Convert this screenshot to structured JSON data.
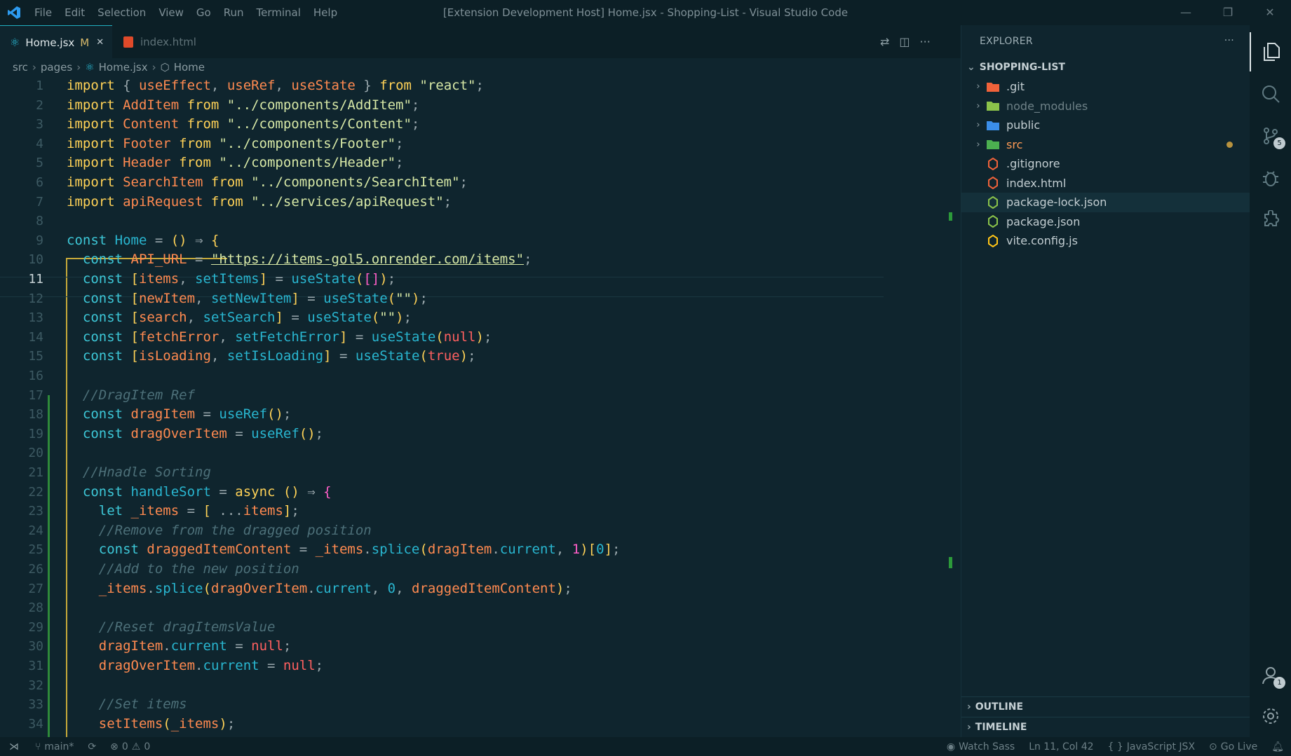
{
  "window": {
    "title": "[Extension Development Host] Home.jsx - Shopping-List - Visual Studio Code",
    "menu": [
      "File",
      "Edit",
      "Selection",
      "View",
      "Go",
      "Run",
      "Terminal",
      "Help"
    ],
    "controls": [
      "—",
      "❐",
      "✕"
    ]
  },
  "tabs": [
    {
      "label": "Home.jsx",
      "badge": "M",
      "close": "✕",
      "active": true
    },
    {
      "label": "index.html",
      "active": false
    }
  ],
  "breadcrumb": [
    "src",
    "pages",
    "Home.jsx",
    "Home"
  ],
  "editor": {
    "current_line": 11,
    "lines": [
      [
        [
          "k",
          "import "
        ],
        [
          "p",
          "{ "
        ],
        [
          "v",
          "useEffect"
        ],
        [
          "p",
          ", "
        ],
        [
          "v",
          "useRef"
        ],
        [
          "p",
          ", "
        ],
        [
          "v",
          "useState"
        ],
        [
          "p",
          " } "
        ],
        [
          "k",
          "from "
        ],
        [
          "s",
          "\"react\""
        ],
        [
          "p",
          ";"
        ]
      ],
      [
        [
          "k",
          "import "
        ],
        [
          "v",
          "AddItem "
        ],
        [
          "k",
          "from "
        ],
        [
          "s",
          "\"../components/AddItem\""
        ],
        [
          "p",
          ";"
        ]
      ],
      [
        [
          "k",
          "import "
        ],
        [
          "v",
          "Content "
        ],
        [
          "k",
          "from "
        ],
        [
          "s",
          "\"../components/Content\""
        ],
        [
          "p",
          ";"
        ]
      ],
      [
        [
          "k",
          "import "
        ],
        [
          "v",
          "Footer "
        ],
        [
          "k",
          "from "
        ],
        [
          "s",
          "\"../components/Footer\""
        ],
        [
          "p",
          ";"
        ]
      ],
      [
        [
          "k",
          "import "
        ],
        [
          "v",
          "Header "
        ],
        [
          "k",
          "from "
        ],
        [
          "s",
          "\"../components/Header\""
        ],
        [
          "p",
          ";"
        ]
      ],
      [
        [
          "k",
          "import "
        ],
        [
          "v",
          "SearchItem "
        ],
        [
          "k",
          "from "
        ],
        [
          "s",
          "\"../components/SearchItem\""
        ],
        [
          "p",
          ";"
        ]
      ],
      [
        [
          "k",
          "import "
        ],
        [
          "v",
          "apiRequest "
        ],
        [
          "k",
          "from "
        ],
        [
          "s",
          "\"../services/apiRequest\""
        ],
        [
          "p",
          ";"
        ]
      ],
      [],
      [
        [
          "c",
          "const "
        ],
        [
          "n",
          "Home "
        ],
        [
          "p",
          "= "
        ],
        [
          "k",
          "() "
        ],
        [
          "p",
          "⇒ "
        ],
        [
          "k",
          "{"
        ]
      ],
      [
        [
          "p",
          "  "
        ],
        [
          "c",
          "const "
        ],
        [
          "v",
          "API_URL "
        ],
        [
          "p",
          "= "
        ],
        [
          "s",
          "\"https://items-gol5.onrender.com/items\""
        ],
        [
          "p",
          ";"
        ]
      ],
      [
        [
          "p",
          "  "
        ],
        [
          "c",
          "const "
        ],
        [
          "k",
          "["
        ],
        [
          "v",
          "items"
        ],
        [
          "p",
          ", "
        ],
        [
          "n",
          "setItems"
        ],
        [
          "k",
          "] "
        ],
        [
          "p",
          "= "
        ],
        [
          "n",
          "useState"
        ],
        [
          "k",
          "("
        ],
        [
          "pk",
          "[]"
        ],
        [
          "k",
          ")"
        ],
        [
          "p",
          ";"
        ]
      ],
      [
        [
          "p",
          "  "
        ],
        [
          "c",
          "const "
        ],
        [
          "k",
          "["
        ],
        [
          "v",
          "newItem"
        ],
        [
          "p",
          ", "
        ],
        [
          "n",
          "setNewItem"
        ],
        [
          "k",
          "] "
        ],
        [
          "p",
          "= "
        ],
        [
          "n",
          "useState"
        ],
        [
          "k",
          "("
        ],
        [
          "s",
          "\"\""
        ],
        [
          "k",
          ")"
        ],
        [
          "p",
          ";"
        ]
      ],
      [
        [
          "p",
          "  "
        ],
        [
          "c",
          "const "
        ],
        [
          "k",
          "["
        ],
        [
          "v",
          "search"
        ],
        [
          "p",
          ", "
        ],
        [
          "n",
          "setSearch"
        ],
        [
          "k",
          "] "
        ],
        [
          "p",
          "= "
        ],
        [
          "n",
          "useState"
        ],
        [
          "k",
          "("
        ],
        [
          "s",
          "\"\""
        ],
        [
          "k",
          ")"
        ],
        [
          "p",
          ";"
        ]
      ],
      [
        [
          "p",
          "  "
        ],
        [
          "c",
          "const "
        ],
        [
          "k",
          "["
        ],
        [
          "v",
          "fetchError"
        ],
        [
          "p",
          ", "
        ],
        [
          "n",
          "setFetchError"
        ],
        [
          "k",
          "] "
        ],
        [
          "p",
          "= "
        ],
        [
          "n",
          "useState"
        ],
        [
          "k",
          "("
        ],
        [
          "r",
          "null"
        ],
        [
          "k",
          ")"
        ],
        [
          "p",
          ";"
        ]
      ],
      [
        [
          "p",
          "  "
        ],
        [
          "c",
          "const "
        ],
        [
          "k",
          "["
        ],
        [
          "v",
          "isLoading"
        ],
        [
          "p",
          ", "
        ],
        [
          "n",
          "setIsLoading"
        ],
        [
          "k",
          "] "
        ],
        [
          "p",
          "= "
        ],
        [
          "n",
          "useState"
        ],
        [
          "k",
          "("
        ],
        [
          "r",
          "true"
        ],
        [
          "k",
          ")"
        ],
        [
          "p",
          ";"
        ]
      ],
      [],
      [
        [
          "p",
          "  "
        ],
        [
          "cm",
          "//DragItem Ref"
        ]
      ],
      [
        [
          "p",
          "  "
        ],
        [
          "c",
          "const "
        ],
        [
          "v",
          "dragItem "
        ],
        [
          "p",
          "= "
        ],
        [
          "n",
          "useRef"
        ],
        [
          "k",
          "()"
        ],
        [
          "p",
          ";"
        ]
      ],
      [
        [
          "p",
          "  "
        ],
        [
          "c",
          "const "
        ],
        [
          "v",
          "dragOverItem "
        ],
        [
          "p",
          "= "
        ],
        [
          "n",
          "useRef"
        ],
        [
          "k",
          "()"
        ],
        [
          "p",
          ";"
        ]
      ],
      [],
      [
        [
          "p",
          "  "
        ],
        [
          "cm",
          "//Hnadle Sorting"
        ]
      ],
      [
        [
          "p",
          "  "
        ],
        [
          "c",
          "const "
        ],
        [
          "n",
          "handleSort "
        ],
        [
          "p",
          "= "
        ],
        [
          "k",
          "async "
        ],
        [
          "k",
          "() "
        ],
        [
          "p",
          "⇒ "
        ],
        [
          "pk",
          "{"
        ]
      ],
      [
        [
          "p",
          "    "
        ],
        [
          "c",
          "let "
        ],
        [
          "v",
          "_items "
        ],
        [
          "p",
          "= "
        ],
        [
          "k",
          "[ "
        ],
        [
          "p",
          "..."
        ],
        [
          "v",
          "items"
        ],
        [
          "k",
          "]"
        ],
        [
          "p",
          ";"
        ]
      ],
      [
        [
          "p",
          "    "
        ],
        [
          "cm",
          "//Remove from the dragged position"
        ]
      ],
      [
        [
          "p",
          "    "
        ],
        [
          "c",
          "const "
        ],
        [
          "v",
          "draggedItemContent "
        ],
        [
          "p",
          "= "
        ],
        [
          "v",
          "_items"
        ],
        [
          "p",
          "."
        ],
        [
          "n",
          "splice"
        ],
        [
          "k",
          "("
        ],
        [
          "v",
          "dragItem"
        ],
        [
          "p",
          "."
        ],
        [
          "n",
          "current"
        ],
        [
          "p",
          ", "
        ],
        [
          "pk",
          "1"
        ],
        [
          "k",
          ")"
        ],
        [
          "k",
          "["
        ],
        [
          "n",
          "0"
        ],
        [
          "k",
          "]"
        ],
        [
          "p",
          ";"
        ]
      ],
      [
        [
          "p",
          "    "
        ],
        [
          "cm",
          "//Add to the new position"
        ]
      ],
      [
        [
          "p",
          "    "
        ],
        [
          "v",
          "_items"
        ],
        [
          "p",
          "."
        ],
        [
          "n",
          "splice"
        ],
        [
          "k",
          "("
        ],
        [
          "v",
          "dragOverItem"
        ],
        [
          "p",
          "."
        ],
        [
          "n",
          "current"
        ],
        [
          "p",
          ", "
        ],
        [
          "n",
          "0"
        ],
        [
          "p",
          ", "
        ],
        [
          "v",
          "draggedItemContent"
        ],
        [
          "k",
          ")"
        ],
        [
          "p",
          ";"
        ]
      ],
      [],
      [
        [
          "p",
          "    "
        ],
        [
          "cm",
          "//Reset dragItemsValue"
        ]
      ],
      [
        [
          "p",
          "    "
        ],
        [
          "v",
          "dragItem"
        ],
        [
          "p",
          "."
        ],
        [
          "n",
          "current "
        ],
        [
          "p",
          "= "
        ],
        [
          "r",
          "null"
        ],
        [
          "p",
          ";"
        ]
      ],
      [
        [
          "p",
          "    "
        ],
        [
          "v",
          "dragOverItem"
        ],
        [
          "p",
          "."
        ],
        [
          "n",
          "current "
        ],
        [
          "p",
          "= "
        ],
        [
          "r",
          "null"
        ],
        [
          "p",
          ";"
        ]
      ],
      [],
      [
        [
          "p",
          "    "
        ],
        [
          "cm",
          "//Set items"
        ]
      ],
      [
        [
          "p",
          "    "
        ],
        [
          "v",
          "setItems"
        ],
        [
          "k",
          "("
        ],
        [
          "v",
          "_items"
        ],
        [
          "k",
          ")"
        ],
        [
          "p",
          ";"
        ]
      ]
    ]
  },
  "explorer": {
    "header": "EXPLORER",
    "more": "···",
    "project": "SHOPPING-LIST",
    "items": [
      {
        "name": ".git",
        "type": "folder",
        "icon": "git-folder-icon",
        "color": "#f0623a"
      },
      {
        "name": "node_modules",
        "type": "folder",
        "icon": "node-folder-icon",
        "color": "#8bc34a",
        "dim": true
      },
      {
        "name": "public",
        "type": "folder",
        "icon": "public-folder-icon",
        "color": "#3b8ee8"
      },
      {
        "name": "src",
        "type": "folder",
        "icon": "src-folder-icon",
        "color": "#4caf50",
        "modified": true
      },
      {
        "name": ".gitignore",
        "type": "file",
        "icon": "git-icon",
        "color": "#f0623a"
      },
      {
        "name": "index.html",
        "type": "file",
        "icon": "html-icon",
        "color": "#f0623a"
      },
      {
        "name": "package-lock.json",
        "type": "file",
        "icon": "nodejs-icon",
        "color": "#8bc34a",
        "selected": true
      },
      {
        "name": "package.json",
        "type": "file",
        "icon": "nodejs-icon",
        "color": "#8bc34a"
      },
      {
        "name": "vite.config.js",
        "type": "file",
        "icon": "vite-icon",
        "color": "#ffc517"
      }
    ],
    "outline": "OUTLINE",
    "timeline": "TIMELINE"
  },
  "activity": {
    "scm_badge": "5",
    "account_badge": "1"
  },
  "status": {
    "branch": "main*",
    "errors": "0",
    "warnings": "0",
    "watch_sass": "Watch Sass",
    "position": "Ln 11, Col 42",
    "braces": "{ }",
    "language": "JavaScript JSX",
    "go_live": "Go Live"
  }
}
